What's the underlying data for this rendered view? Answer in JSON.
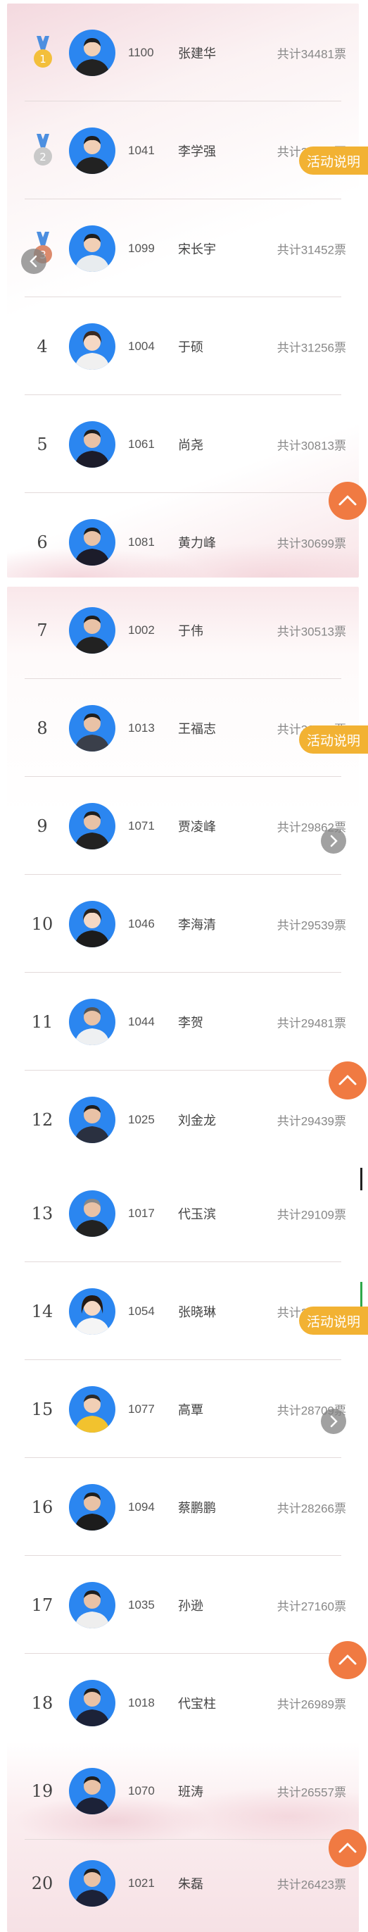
{
  "colors": {
    "avatar_bg": "#2b86f0",
    "float_info_bg": "#f2b233",
    "float_top_bg": "#f07a42",
    "medal_gold": "#f3bf3b",
    "medal_silver": "#c9c9c9",
    "medal_bronze": "#dc8a6c",
    "ribbon_blue": "#4c8fe0"
  },
  "float": {
    "info_label": "活动说明",
    "top_icon": "chevron-up-icon",
    "back_icon": "chevron-left-icon"
  },
  "entries": [
    {
      "rank": "1",
      "code": "1100",
      "name": "张建华",
      "votes": "共计34481票"
    },
    {
      "rank": "2",
      "code": "1041",
      "name": "李学强",
      "votes": "共计33149票"
    },
    {
      "rank": "3",
      "code": "1099",
      "name": "宋长宇",
      "votes": "共计31452票"
    },
    {
      "rank": "4",
      "code": "1004",
      "name": "于硕",
      "votes": "共计31256票"
    },
    {
      "rank": "5",
      "code": "1061",
      "name": "尚尧",
      "votes": "共计30813票"
    },
    {
      "rank": "6",
      "code": "1081",
      "name": "黄力峰",
      "votes": "共计30699票"
    },
    {
      "rank": "7",
      "code": "1002",
      "name": "于伟",
      "votes": "共计30513票"
    },
    {
      "rank": "8",
      "code": "1013",
      "name": "王福志",
      "votes": "共计30318票"
    },
    {
      "rank": "9",
      "code": "1071",
      "name": "贾凌峰",
      "votes": "共计29862票"
    },
    {
      "rank": "10",
      "code": "1046",
      "name": "李海清",
      "votes": "共计29539票"
    },
    {
      "rank": "11",
      "code": "1044",
      "name": "李贺",
      "votes": "共计29481票"
    },
    {
      "rank": "12",
      "code": "1025",
      "name": "刘金龙",
      "votes": "共计29439票"
    },
    {
      "rank": "13",
      "code": "1017",
      "name": "代玉滨",
      "votes": "共计29109票"
    },
    {
      "rank": "14",
      "code": "1054",
      "name": "张晓琳",
      "votes": "共计28958票"
    },
    {
      "rank": "15",
      "code": "1077",
      "name": "高覃",
      "votes": "共计28709票"
    },
    {
      "rank": "16",
      "code": "1094",
      "name": "蔡鹏鹏",
      "votes": "共计28266票"
    },
    {
      "rank": "17",
      "code": "1035",
      "name": "孙逊",
      "votes": "共计27160票"
    },
    {
      "rank": "18",
      "code": "1018",
      "name": "代宝柱",
      "votes": "共计26989票"
    },
    {
      "rank": "19",
      "code": "1070",
      "name": "班涛",
      "votes": "共计26557票"
    },
    {
      "rank": "20",
      "code": "1021",
      "name": "朱磊",
      "votes": "共计26423票"
    }
  ]
}
